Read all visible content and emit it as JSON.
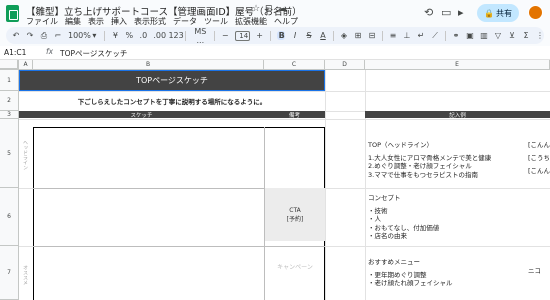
{
  "title": {
    "doc_title": "【雛型】立ち上げサポートコース【管理画面ID】屋号（お名前）",
    "star_icon": "star-icon",
    "move_icon": "folder-icon",
    "cloud_icon": "cloud-icon",
    "share_label": "共有"
  },
  "menu": [
    "ファイル",
    "編集",
    "表示",
    "挿入",
    "表示形式",
    "データ",
    "ツール",
    "拡張機能",
    "ヘルプ"
  ],
  "toolbar": {
    "zoom": "100%",
    "currency": "¥",
    "percent": "%",
    "dec_less": ".0",
    "dec_more": ".00",
    "number_format": "123",
    "font": "MS ...",
    "font_size": "14",
    "bold": "B",
    "italic": "I",
    "strike": "S",
    "text_color": "A"
  },
  "formula_bar": {
    "cell_ref": "A1:C1",
    "fx": "fx",
    "formula": "TOPページスケッチ"
  },
  "columns": [
    "A",
    "B",
    "C",
    "D",
    "E"
  ],
  "rows": [
    "1",
    "2",
    "3",
    "5",
    "6",
    "7"
  ],
  "sheet": {
    "banner": "TOPページスケッチ",
    "subtitle": "下ごしらえしたコンセプトを丁寧に説明する場所になるように。",
    "hdr_sketch": "スケッチ",
    "hdr_notes": "備考",
    "hdr_example": "記入例",
    "side_label_5": "ヘッドライン",
    "side_label_7": "オススメ",
    "cta_line1": "CTA",
    "cta_line2": "[予約]",
    "campaign": "キャンペーン"
  },
  "example": {
    "headline_title": "TOP（ヘッドライン）",
    "headline_lines": [
      "1.大人女性にアロマ骨格メンテで美と健康",
      "2.めぐり調整・老け顔フェイシャル",
      "3.ママで仕事をもつセラピストの指南"
    ],
    "concept_title": "コンセプト",
    "concept_lines": [
      "・技術",
      "・人",
      "・おもてなし、付加価値",
      "・店名の由来"
    ],
    "menu_title": "おすすめメニュー",
    "menu_lines": [
      "・更年期めぐり調整",
      "・老け顔たれ顔フェイシャル"
    ],
    "overflow_1": "[こんん",
    "overflow_2": "[こうち",
    "overflow_3": "[こんん",
    "overflow_4": "ニコ"
  }
}
